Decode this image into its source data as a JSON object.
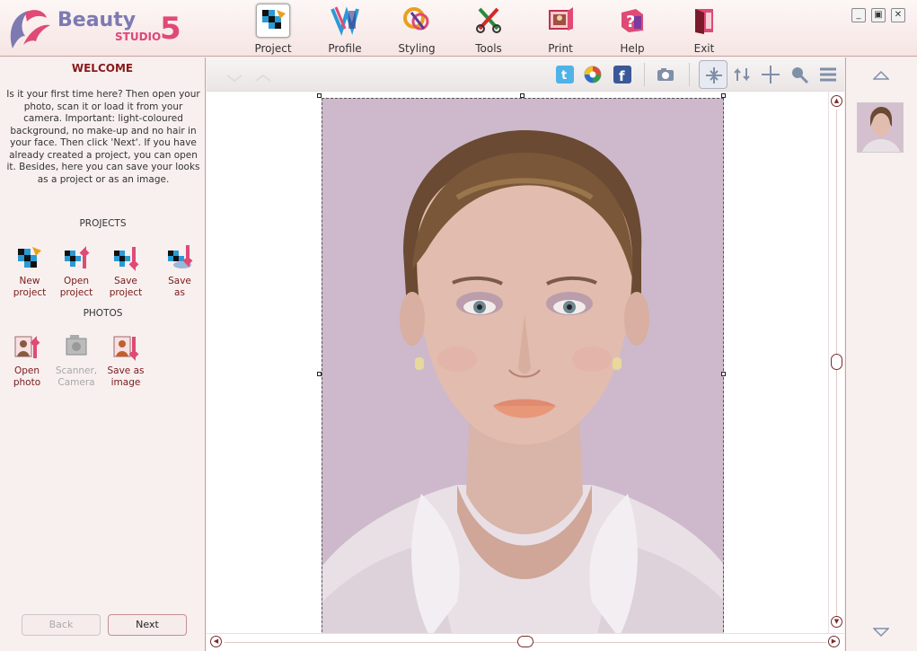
{
  "app": {
    "logo_name": "Beauty",
    "logo_studio": "STUDIO",
    "logo_version": "5"
  },
  "toolbar": {
    "items": [
      {
        "label": "Project",
        "icon": "project-icon"
      },
      {
        "label": "Profile",
        "icon": "profile-icon"
      },
      {
        "label": "Styling",
        "icon": "styling-icon"
      },
      {
        "label": "Tools",
        "icon": "tools-icon"
      },
      {
        "label": "Print",
        "icon": "print-icon"
      },
      {
        "label": "Help",
        "icon": "help-icon"
      },
      {
        "label": "Exit",
        "icon": "exit-icon"
      }
    ],
    "active": "Project"
  },
  "window_controls": {
    "minimize": "_",
    "maximize": "▣",
    "close": "✕"
  },
  "left_panel": {
    "title": "WELCOME",
    "intro": "Is it your first time here? Then open your photo, scan it or load it from your camera. Important: light-coloured background, no make-up and no hair in your face. Then click 'Next'. If you have already created a project, you can open it. Besides, here you can save your looks as a project or as an image.",
    "projects_heading": "PROJECTS",
    "projects": [
      {
        "line1": "New",
        "line2": "project"
      },
      {
        "line1": "Open",
        "line2": "project"
      },
      {
        "line1": "Save",
        "line2": "project"
      },
      {
        "line1": "Save",
        "line2": "as"
      }
    ],
    "photos_heading": "PHOTOS",
    "photos": [
      {
        "line1": "Open",
        "line2": "photo"
      },
      {
        "line1": "Scanner,",
        "line2": "Camera"
      },
      {
        "line1": "Save as",
        "line2": "image"
      }
    ],
    "back_label": "Back",
    "next_label": "Next"
  },
  "colors": {
    "accent": "#e0457a",
    "panel_bg": "#f7f0ef",
    "border": "#c9a2a1",
    "photo_bg": "#cdb9cb"
  }
}
